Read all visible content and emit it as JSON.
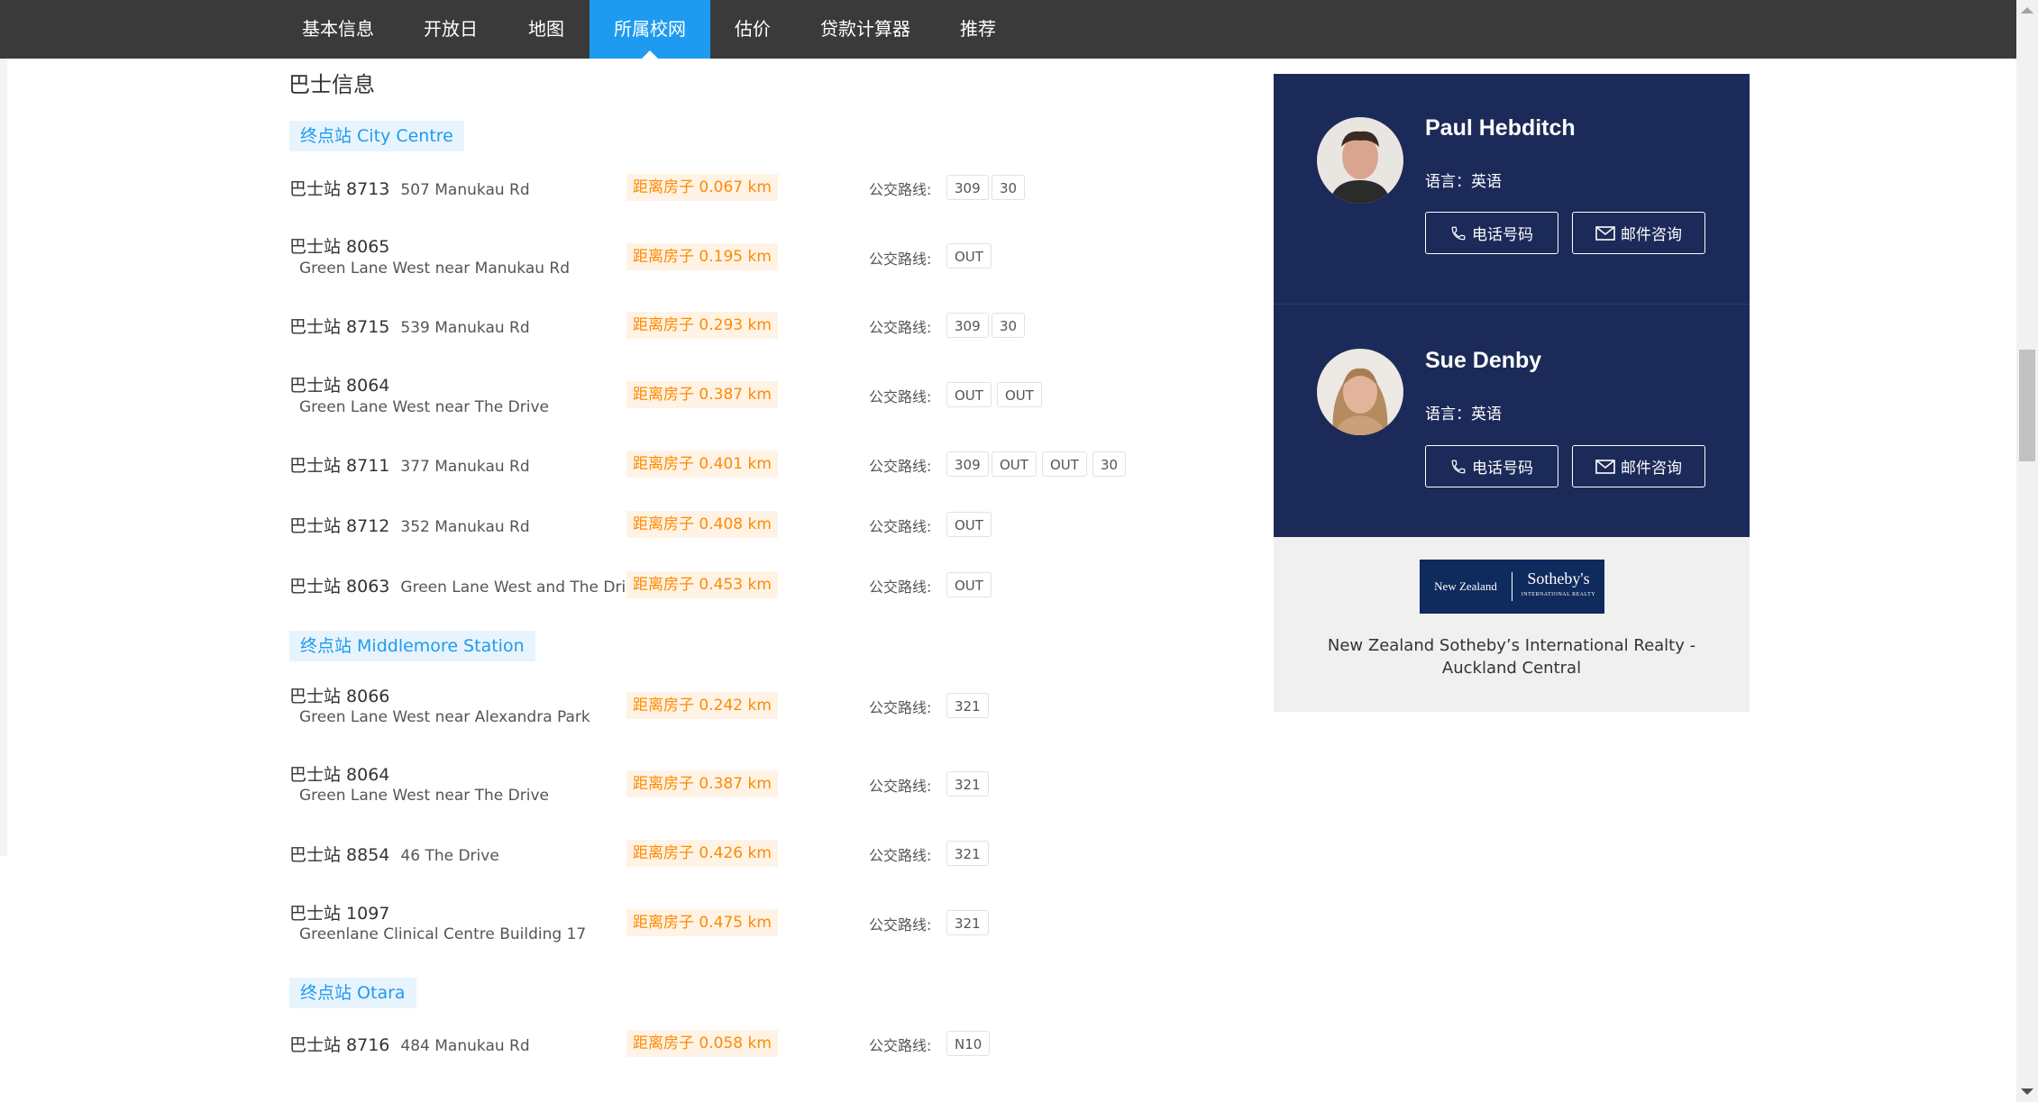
{
  "nav": {
    "tabs": [
      {
        "label": "基本信息"
      },
      {
        "label": "开放日"
      },
      {
        "label": "地图"
      },
      {
        "label": "所属校网",
        "active": true
      },
      {
        "label": "估价"
      },
      {
        "label": "贷款计算器"
      },
      {
        "label": "推荐"
      }
    ]
  },
  "bus": {
    "title": "巴士信息",
    "route_label": "公交路线:",
    "groups": [
      {
        "terminal": "终点站 City Centre",
        "stops": [
          {
            "name": "巴士站 8713",
            "address": "507 Manukau Rd",
            "distance": "距离房子 0.067 km",
            "routes": [
              "309",
              "30"
            ]
          },
          {
            "name": "巴士站 8065",
            "address": "Green Lane West near Manukau Rd",
            "distance": "距离房子 0.195 km",
            "routes": [
              "OUT"
            ]
          },
          {
            "name": "巴士站 8715",
            "address": "539 Manukau Rd",
            "distance": "距离房子 0.293 km",
            "routes": [
              "309",
              "30"
            ]
          },
          {
            "name": "巴士站 8064",
            "address": "Green Lane West near The Drive",
            "distance": "距离房子 0.387 km",
            "routes": [
              "OUT",
              "OUT"
            ]
          },
          {
            "name": "巴士站 8711",
            "address": "377 Manukau Rd",
            "distance": "距离房子 0.401 km",
            "routes": [
              "309",
              "OUT",
              "OUT",
              "30"
            ]
          },
          {
            "name": "巴士站 8712",
            "address": "352 Manukau Rd",
            "distance": "距离房子 0.408 km",
            "routes": [
              "OUT"
            ]
          },
          {
            "name": "巴士站 8063",
            "address": "Green Lane West and The Drive",
            "distance": "距离房子 0.453 km",
            "routes": [
              "OUT"
            ]
          }
        ]
      },
      {
        "terminal": "终点站 Middlemore Station",
        "stops": [
          {
            "name": "巴士站 8066",
            "address": "Green Lane West near Alexandra Park",
            "distance": "距离房子 0.242 km",
            "routes": [
              "321"
            ]
          },
          {
            "name": "巴士站 8064",
            "address": "Green Lane West near The Drive",
            "distance": "距离房子 0.387 km",
            "routes": [
              "321"
            ]
          },
          {
            "name": "巴士站 8854",
            "address": "46 The Drive",
            "distance": "距离房子 0.426 km",
            "routes": [
              "321"
            ]
          },
          {
            "name": "巴士站 1097",
            "address": "Greenlane Clinical Centre Building 17",
            "distance": "距离房子 0.475 km",
            "routes": [
              "321"
            ]
          }
        ]
      },
      {
        "terminal": "终点站 Otara",
        "stops": [
          {
            "name": "巴士站 8716",
            "address": "484 Manukau Rd",
            "distance": "距离房子 0.058 km",
            "routes": [
              "N10"
            ]
          }
        ]
      }
    ]
  },
  "agents": [
    {
      "name": "Paul Hebditch",
      "language": "语言：英语",
      "phone_label": "电话号码",
      "email_label": "邮件咨询"
    },
    {
      "name": "Sue Denby",
      "language": "语言：英语",
      "phone_label": "电话号码",
      "email_label": "邮件咨询"
    }
  ],
  "agency": {
    "logo_left": "New Zealand",
    "logo_right": "Sotheby's",
    "logo_sub": "INTERNATIONAL REALTY",
    "name": "New Zealand Sotheby’s International Realty - Auckland Central"
  },
  "colors": {
    "nav_bg": "#3a3a3a",
    "nav_active": "#1e9bf0",
    "terminal_text": "#1e9bf0",
    "distance_text": "#ff8a00",
    "agent_card_bg": "#1b2a58"
  }
}
